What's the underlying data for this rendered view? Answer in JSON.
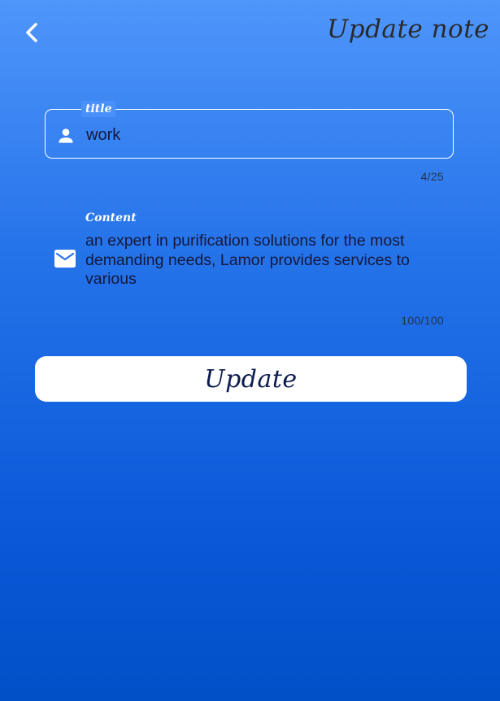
{
  "header": {
    "title": "Update note",
    "back_icon": "chevron-left-icon"
  },
  "form": {
    "title_field": {
      "label": "title",
      "value": "work",
      "counter": "4/25",
      "icon": "person-icon"
    },
    "content_field": {
      "label": "Content",
      "value": "an expert in purification solutions for the most demanding needs, Lamor provides services to various",
      "counter": "100/100",
      "icon": "mail-icon"
    },
    "submit_label": "Update"
  },
  "colors": {
    "gradient_top": "#4f96fb",
    "gradient_bottom": "#0050c8",
    "text_dark": "#16183a",
    "button_bg": "#ffffff"
  }
}
